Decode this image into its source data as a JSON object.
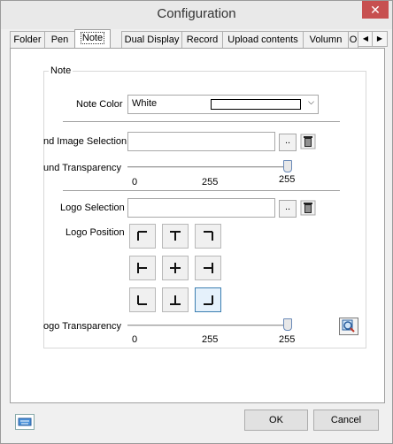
{
  "window": {
    "title": "Configuration",
    "close_glyph": "✕"
  },
  "tabs": [
    {
      "label": "Folder"
    },
    {
      "label": "Pen"
    },
    {
      "label": "Note"
    },
    {
      "label": "Dual Display"
    },
    {
      "label": "Record"
    },
    {
      "label": "Upload contents"
    },
    {
      "label": "Volumn"
    },
    {
      "label": "O"
    }
  ],
  "tab_scroll": {
    "left": "◀",
    "right": "▶"
  },
  "note_group": {
    "title": "Note",
    "note_color_label": "Note Color",
    "note_color_value": "White",
    "dropdown_glyph": "⌵",
    "bg_image_label": "nd Image Selection",
    "bg_image_value": "",
    "browse_label": "..",
    "bg_transparency_label": "und Transparency",
    "bg_transparency": {
      "min": "0",
      "mid": "255",
      "value_label": "255",
      "value": 255,
      "max": 255
    },
    "logo_selection_label": "Logo Selection",
    "logo_selection_value": "",
    "logo_position_label": "Logo Position",
    "logo_positions": [
      "top-left",
      "top-center",
      "top-right",
      "middle-left",
      "center",
      "middle-right",
      "bottom-left",
      "bottom-center",
      "bottom-right"
    ],
    "logo_position_selected": "bottom-right",
    "logo_transparency_label": "ogo Transparency",
    "logo_transparency": {
      "min": "0",
      "mid": "255",
      "value_label": "255",
      "value": 255,
      "max": 255
    }
  },
  "footer": {
    "ok_label": "OK",
    "cancel_label": "Cancel"
  },
  "colors": {
    "accent": "#3c7fb1",
    "close": "#c75050"
  }
}
